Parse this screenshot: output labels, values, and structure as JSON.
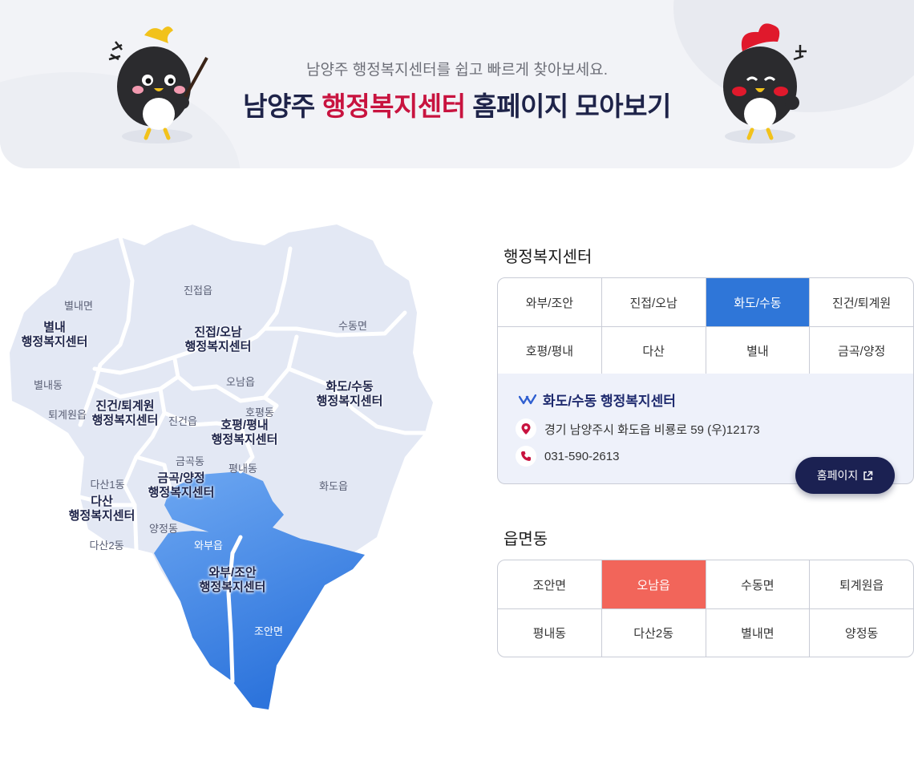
{
  "banner": {
    "subtitle": "남양주 행정복지센터를 쉽고 빠르게 찾아보세요.",
    "title_prefix": "남양주 ",
    "title_highlight": "행정복지센터",
    "title_suffix": " 홈페이지 모아보기"
  },
  "map": {
    "small_labels": [
      "진접읍",
      "별내면",
      "수동면",
      "별내동",
      "오남읍",
      "퇴계원읍",
      "호평동",
      "진건읍",
      "금곡동",
      "평내동",
      "다산1동",
      "화도읍",
      "양정동",
      "다산2동",
      "와부읍",
      "조안면"
    ],
    "center_labels": [
      {
        "line1": "별내",
        "line2": "행정복지센터"
      },
      {
        "line1": "진접/오남",
        "line2": "행정복지센터"
      },
      {
        "line1": "화도/수동",
        "line2": "행정복지센터"
      },
      {
        "line1": "진건/퇴계원",
        "line2": "행정복지센터"
      },
      {
        "line1": "호평/평내",
        "line2": "행정복지센터"
      },
      {
        "line1": "금곡/양정",
        "line2": "행정복지센터"
      },
      {
        "line1": "다산",
        "line2": "행정복지센터"
      },
      {
        "line1": "와부/조안",
        "line2": "행정복지센터"
      }
    ],
    "colors": {
      "land": "#e3e8f4",
      "border": "#ffffff",
      "selected_top": "#6ea8f2",
      "selected_bottom": "#2d74dc"
    }
  },
  "centers": {
    "title": "행정복지센터",
    "rows": [
      [
        "와부/조안",
        "진접/오남",
        "화도/수동",
        "진건/퇴계원"
      ],
      [
        "호평/평내",
        "다산",
        "별내",
        "금곡/양정"
      ]
    ],
    "selected": "화도/수동",
    "selected_color": "#2f76d8"
  },
  "detail": {
    "title": "화도/수동 행정복지센터",
    "address": "경기 남양주시 화도읍 비룡로 59 (우)12173",
    "phone": "031-590-2613",
    "homepage_button": "홈페이지",
    "icons": [
      "chevron-double-icon",
      "location-pin-icon",
      "phone-icon",
      "external-link-icon"
    ]
  },
  "towns": {
    "title": "읍면동",
    "rows": [
      [
        "조안면",
        "오남읍",
        "수동면",
        "퇴계원읍"
      ],
      [
        "평내동",
        "다산2동",
        "별내면",
        "양정동"
      ]
    ],
    "selected": "오남읍",
    "selected_color": "#f2655a"
  }
}
